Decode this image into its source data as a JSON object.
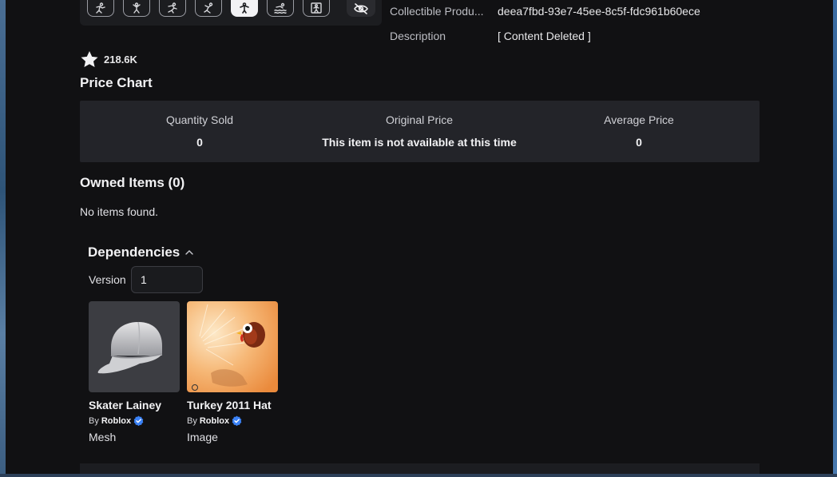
{
  "emotes": [
    {
      "icon": "emote-dance-icon"
    },
    {
      "icon": "emote-climb-icon"
    },
    {
      "icon": "emote-run-icon"
    },
    {
      "icon": "emote-jump-icon"
    },
    {
      "icon": "emote-fall-icon"
    },
    {
      "icon": "emote-swim-icon"
    },
    {
      "icon": "emote-idle-icon"
    }
  ],
  "details": {
    "collectible_label": "Collectible Produ...",
    "collectible_value": "deea7fbd-93e7-45ee-8c5f-fdc961b60ece",
    "description_label": "Description",
    "description_value": "[ Content Deleted ]"
  },
  "favorites": {
    "count": "218.6K"
  },
  "price_chart": {
    "title": "Price Chart",
    "columns": [
      {
        "header": "Quantity Sold",
        "value": "0"
      },
      {
        "header": "Original Price",
        "value": "This item is not available at this time"
      },
      {
        "header": "Average Price",
        "value": "0"
      }
    ]
  },
  "owned": {
    "title": "Owned Items (0)",
    "empty_text": "No items found."
  },
  "dependencies": {
    "title": "Dependencies",
    "version_label": "Version",
    "version_value": "1",
    "items": [
      {
        "name": "Skater Lainey",
        "by_prefix": "By",
        "creator": "Roblox",
        "type": "Mesh"
      },
      {
        "name": "Turkey 2011 Hat",
        "by_prefix": "By",
        "creator": "Roblox",
        "type": "Image"
      }
    ]
  },
  "colors": {
    "background": "#111113",
    "panel": "#232429",
    "verified": "#3b82f6"
  }
}
